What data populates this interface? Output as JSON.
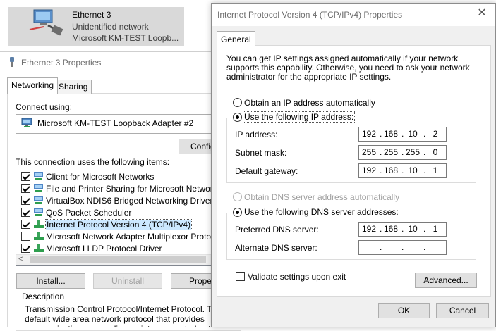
{
  "connection_tile": {
    "name": "Ethernet 3",
    "status": "Unidentified network",
    "device": "Microsoft KM-TEST Loopb..."
  },
  "ethernet_properties": {
    "title": "Ethernet 3 Properties",
    "tabs": [
      "Networking",
      "Sharing"
    ],
    "connect_using_label": "Connect using:",
    "adapter_name": "Microsoft KM-TEST Loopback Adapter #2",
    "configure_label": "Configu",
    "items_label": "This connection uses the following items:",
    "items": [
      {
        "label": "Client for Microsoft Networks",
        "checked": true,
        "icon": "network-client-icon"
      },
      {
        "label": "File and Printer Sharing for Microsoft Networks",
        "checked": true,
        "icon": "network-service-icon"
      },
      {
        "label": "VirtualBox NDIS6 Bridged Networking Driver",
        "checked": true,
        "icon": "network-service-icon"
      },
      {
        "label": "QoS Packet Scheduler",
        "checked": true,
        "icon": "network-service-icon"
      },
      {
        "label": "Internet Protocol Version 4 (TCP/IPv4)",
        "checked": true,
        "icon": "protocol-icon",
        "selected": true
      },
      {
        "label": "Microsoft Network Adapter Multiplexor Protocol",
        "checked": false,
        "icon": "protocol-icon"
      },
      {
        "label": "Microsoft LLDP Protocol Driver",
        "checked": true,
        "icon": "protocol-icon"
      }
    ],
    "scroll_left_glyph": "<",
    "install_label": "Install...",
    "uninstall_label": "Uninstall",
    "properties_label": "Propert",
    "description_legend": "Description",
    "description_text": "Transmission Control Protocol/Internet Protocol. The default wide area network protocol that provides communication across diverse interconnected networks."
  },
  "ipv4_dialog": {
    "title": "Internet Protocol Version 4 (TCP/IPv4) Properties",
    "close_glyph": "✕",
    "tab": "General",
    "intro": "You can get IP settings assigned automatically if your network supports this capability. Otherwise, you need to ask your network administrator for the appropriate IP settings.",
    "obtain_ip_auto": "Obtain an IP address automatically",
    "use_following_ip": "Use the following IP address:",
    "ip_fields": [
      {
        "label": "IP address:",
        "octets": [
          "192",
          "168",
          "10",
          "2"
        ]
      },
      {
        "label": "Subnet mask:",
        "octets": [
          "255",
          "255",
          "255",
          "0"
        ]
      },
      {
        "label": "Default gateway:",
        "octets": [
          "192",
          "168",
          "10",
          "1"
        ]
      }
    ],
    "obtain_dns_auto": "Obtain DNS server address automatically",
    "use_following_dns": "Use the following DNS server addresses:",
    "dns_fields": [
      {
        "label": "Preferred DNS server:",
        "octets": [
          "192",
          "168",
          "10",
          "1"
        ]
      },
      {
        "label": "Alternate DNS server:",
        "octets": [
          "",
          "",
          "",
          ""
        ]
      }
    ],
    "validate_label": "Validate settings upon exit",
    "advanced_label": "Advanced...",
    "ok_label": "OK",
    "cancel_label": "Cancel"
  },
  "colors": {
    "tile_bg": "#d9d9d9",
    "selection": "#cce8ff",
    "button_bg": "#e1e1e1",
    "dialog_bg": "#f0f0f0"
  }
}
